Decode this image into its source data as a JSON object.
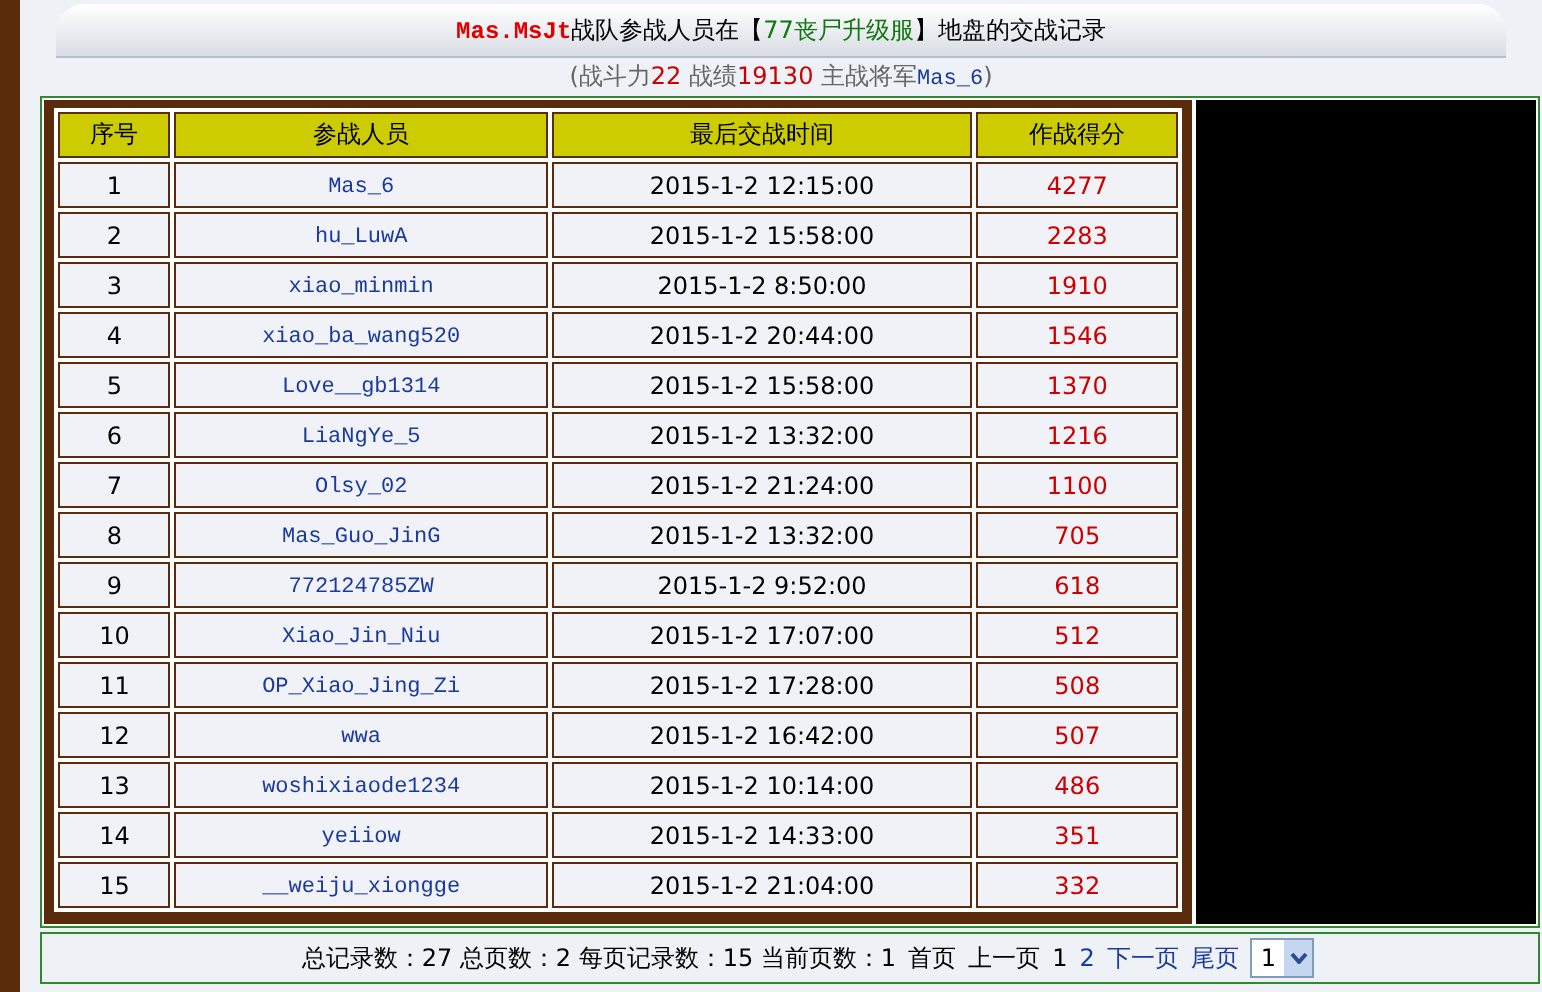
{
  "title": [
    {
      "kind": "team",
      "text": "Mas.MsJt"
    },
    {
      "kind": "plain",
      "text": "战队参战人员在【"
    },
    {
      "kind": "map",
      "text": "77丧尸升级服"
    },
    {
      "kind": "plain",
      "text": "】地盘的交战记录"
    }
  ],
  "subtitle": [
    {
      "kind": "plain",
      "text": "(战斗力"
    },
    {
      "kind": "value",
      "text": "22"
    },
    {
      "kind": "plain",
      "text": " 战绩"
    },
    {
      "kind": "value",
      "text": "19130"
    },
    {
      "kind": "plain",
      "text": " 主战将军"
    },
    {
      "kind": "name",
      "text": "Mas_6"
    },
    {
      "kind": "plain",
      "text": ")"
    }
  ],
  "table": {
    "columns": [
      "序号",
      "参战人员",
      "最后交战时间",
      "作战得分"
    ],
    "rows": [
      [
        "1",
        "Mas_6",
        "2015-1-2 12:15:00",
        "4277"
      ],
      [
        "2",
        "hu_LuwA",
        "2015-1-2 15:58:00",
        "2283"
      ],
      [
        "3",
        "xiao_minmin",
        "2015-1-2 8:50:00",
        "1910"
      ],
      [
        "4",
        "xiao_ba_wang520",
        "2015-1-2 20:44:00",
        "1546"
      ],
      [
        "5",
        "Love__gb1314",
        "2015-1-2 15:58:00",
        "1370"
      ],
      [
        "6",
        "LiaNgYe_5",
        "2015-1-2 13:32:00",
        "1216"
      ],
      [
        "7",
        "Olsy_02",
        "2015-1-2 21:24:00",
        "1100"
      ],
      [
        "8",
        "Mas_Guo_JinG",
        "2015-1-2 13:32:00",
        "705"
      ],
      [
        "9",
        "772124785ZW",
        "2015-1-2 9:52:00",
        "618"
      ],
      [
        "10",
        "Xiao_Jin_Niu",
        "2015-1-2 17:07:00",
        "512"
      ],
      [
        "11",
        "OP_Xiao_Jing_Zi",
        "2015-1-2 17:28:00",
        "508"
      ],
      [
        "12",
        "wwa",
        "2015-1-2 16:42:00",
        "507"
      ],
      [
        "13",
        "woshixiaode1234",
        "2015-1-2 10:14:00",
        "486"
      ],
      [
        "14",
        "yeiiow",
        "2015-1-2 14:33:00",
        "351"
      ],
      [
        "15",
        "__weiju_xiongge",
        "2015-1-2 21:04:00",
        "332"
      ]
    ]
  },
  "pager": {
    "summary": "总记录数：27 总页数：2 每页记录数：15 当前页数：1",
    "links": [
      {
        "text": "首页",
        "disabled": true
      },
      {
        "text": "上一页",
        "disabled": true
      },
      {
        "text": "1",
        "disabled": true
      },
      {
        "text": "2",
        "disabled": false
      },
      {
        "text": "下一页",
        "disabled": false
      },
      {
        "text": "尾页",
        "disabled": false
      }
    ],
    "page_select": {
      "value": "1"
    }
  }
}
